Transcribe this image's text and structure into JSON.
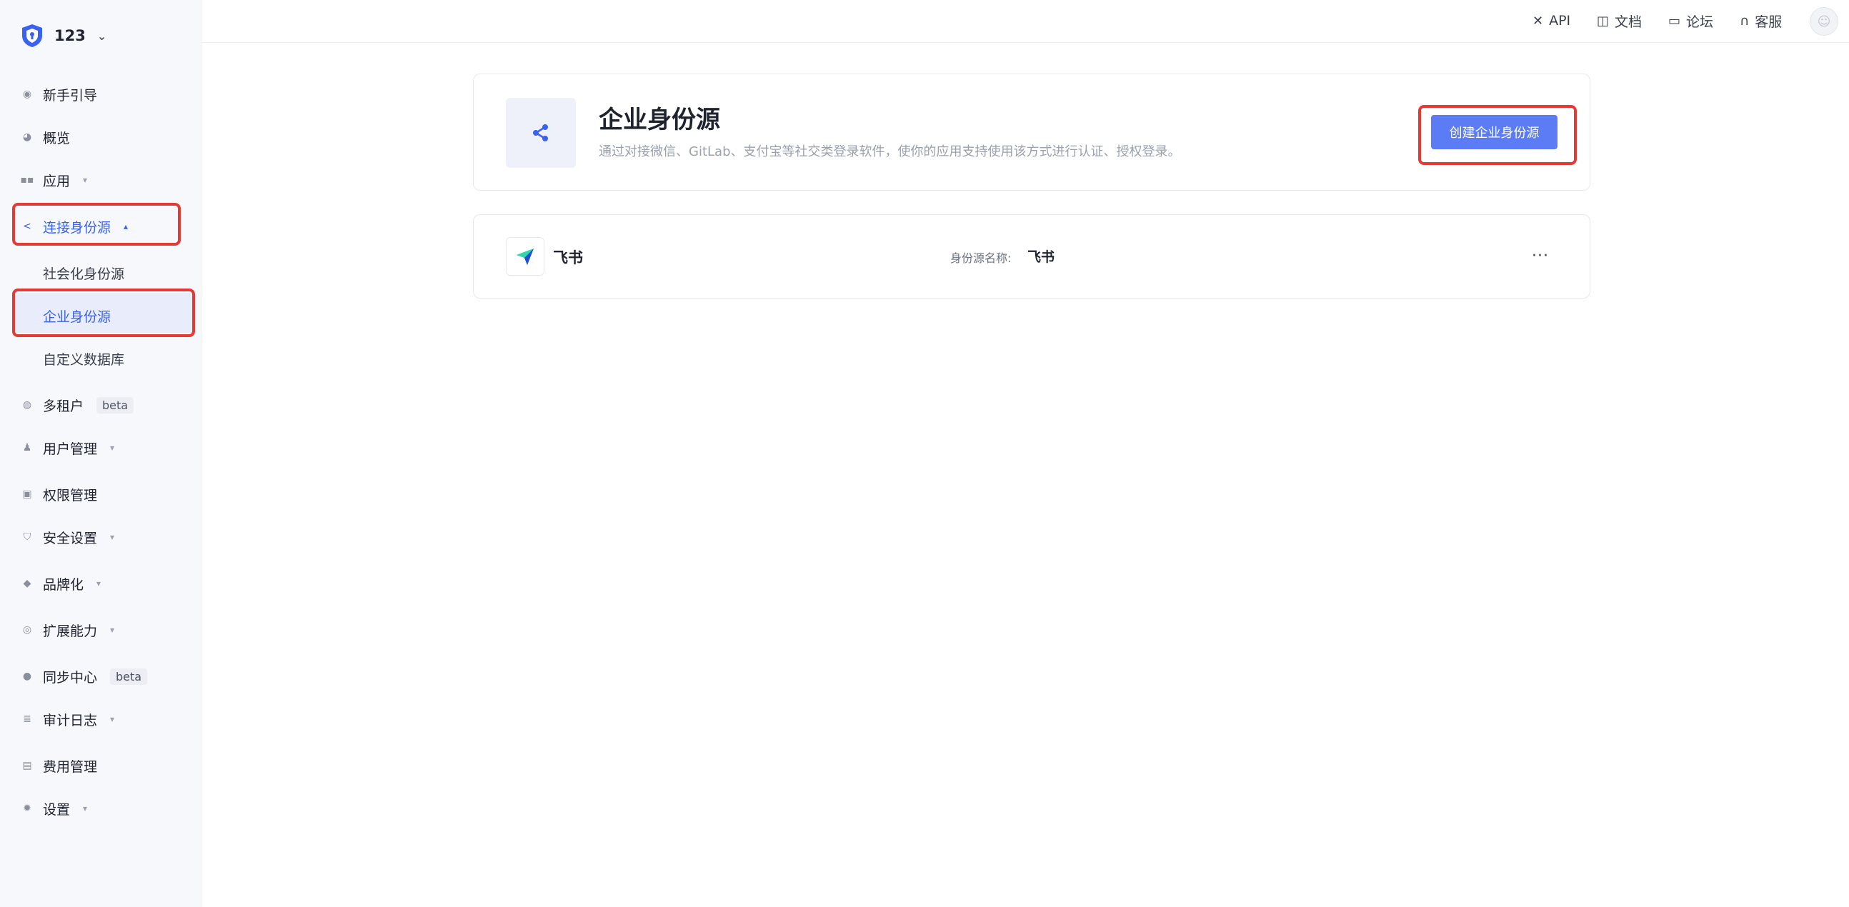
{
  "tenant": {
    "name": "123",
    "caret": "⌄"
  },
  "sidebar": {
    "items": [
      {
        "label": "新手引导"
      },
      {
        "label": "概览"
      },
      {
        "label": "应用",
        "chevron": "▾"
      },
      {
        "label": "连接身份源",
        "chevron": "▴"
      },
      {
        "label": "多租户",
        "badge": "beta"
      },
      {
        "label": "用户管理",
        "chevron": "▾"
      },
      {
        "label": "权限管理"
      },
      {
        "label": "安全设置",
        "chevron": "▾"
      },
      {
        "label": "品牌化",
        "chevron": "▾"
      },
      {
        "label": "扩展能力",
        "chevron": "▾"
      },
      {
        "label": "同步中心",
        "badge": "beta"
      },
      {
        "label": "审计日志",
        "chevron": "▾"
      },
      {
        "label": "费用管理"
      },
      {
        "label": "设置",
        "chevron": "▾"
      }
    ],
    "subitems": [
      {
        "label": "社会化身份源"
      },
      {
        "label": "企业身份源"
      },
      {
        "label": "自定义数据库"
      }
    ]
  },
  "header": {
    "links": [
      {
        "label": "API",
        "icon": "tools-icon"
      },
      {
        "label": "文档",
        "icon": "book-icon"
      },
      {
        "label": "论坛",
        "icon": "message-icon"
      },
      {
        "label": "客服",
        "icon": "headset-icon"
      }
    ]
  },
  "page": {
    "title": "企业身份源",
    "description": "通过对接微信、GitLab、支付宝等社交类登录软件，使你的应用支持使用该方式进行认证、授权登录。",
    "create_button": "创建企业身份源"
  },
  "sources": [
    {
      "name": "飞书",
      "field_label": "身份源名称:",
      "field_value": "飞书",
      "more": "···"
    }
  ],
  "colors": {
    "accent": "#3a62f2",
    "button": "#5b7cf5",
    "highlight": "#e53a33",
    "sidebar_bg": "#f7f8fc"
  }
}
